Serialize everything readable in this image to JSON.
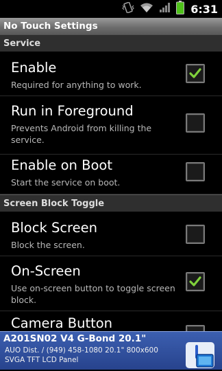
{
  "status_bar": {
    "time": "6:31",
    "icons": [
      "vibrate-icon",
      "wifi-icon",
      "signal-icon",
      "battery-icon"
    ],
    "battery_color": "#4fc21a"
  },
  "title_bar": {
    "title": "No Touch Settings"
  },
  "sections": [
    {
      "header": "Service",
      "items": [
        {
          "title": "Enable",
          "summary": "Required for anything to work.",
          "checked": true
        },
        {
          "title": "Run in Foreground",
          "summary": "Prevents Android from killing the service.",
          "checked": false
        },
        {
          "title": "Enable on Boot",
          "summary": "Start the service on boot.",
          "checked": false
        }
      ]
    },
    {
      "header": "Screen Block Toggle",
      "items": [
        {
          "title": "Block Screen",
          "summary": "Block the screen.",
          "checked": false
        },
        {
          "title": "On-Screen",
          "summary": "Use on-screen button to toggle screen block.",
          "checked": true
        },
        {
          "title": "Camera Button",
          "summary": "",
          "checked": false
        }
      ]
    }
  ],
  "ad_banner": {
    "title": "A201SN02 V4 G-Bond 20.1\"",
    "line1": "AUO Dist. / (949) 458-1080 20.1\" 800x600",
    "line2": "SVGA TFT LCD Panel",
    "icon": "ad-panel-icon"
  },
  "colors": {
    "check_green": "#7fd13b",
    "accent_blue": "#27438d"
  }
}
